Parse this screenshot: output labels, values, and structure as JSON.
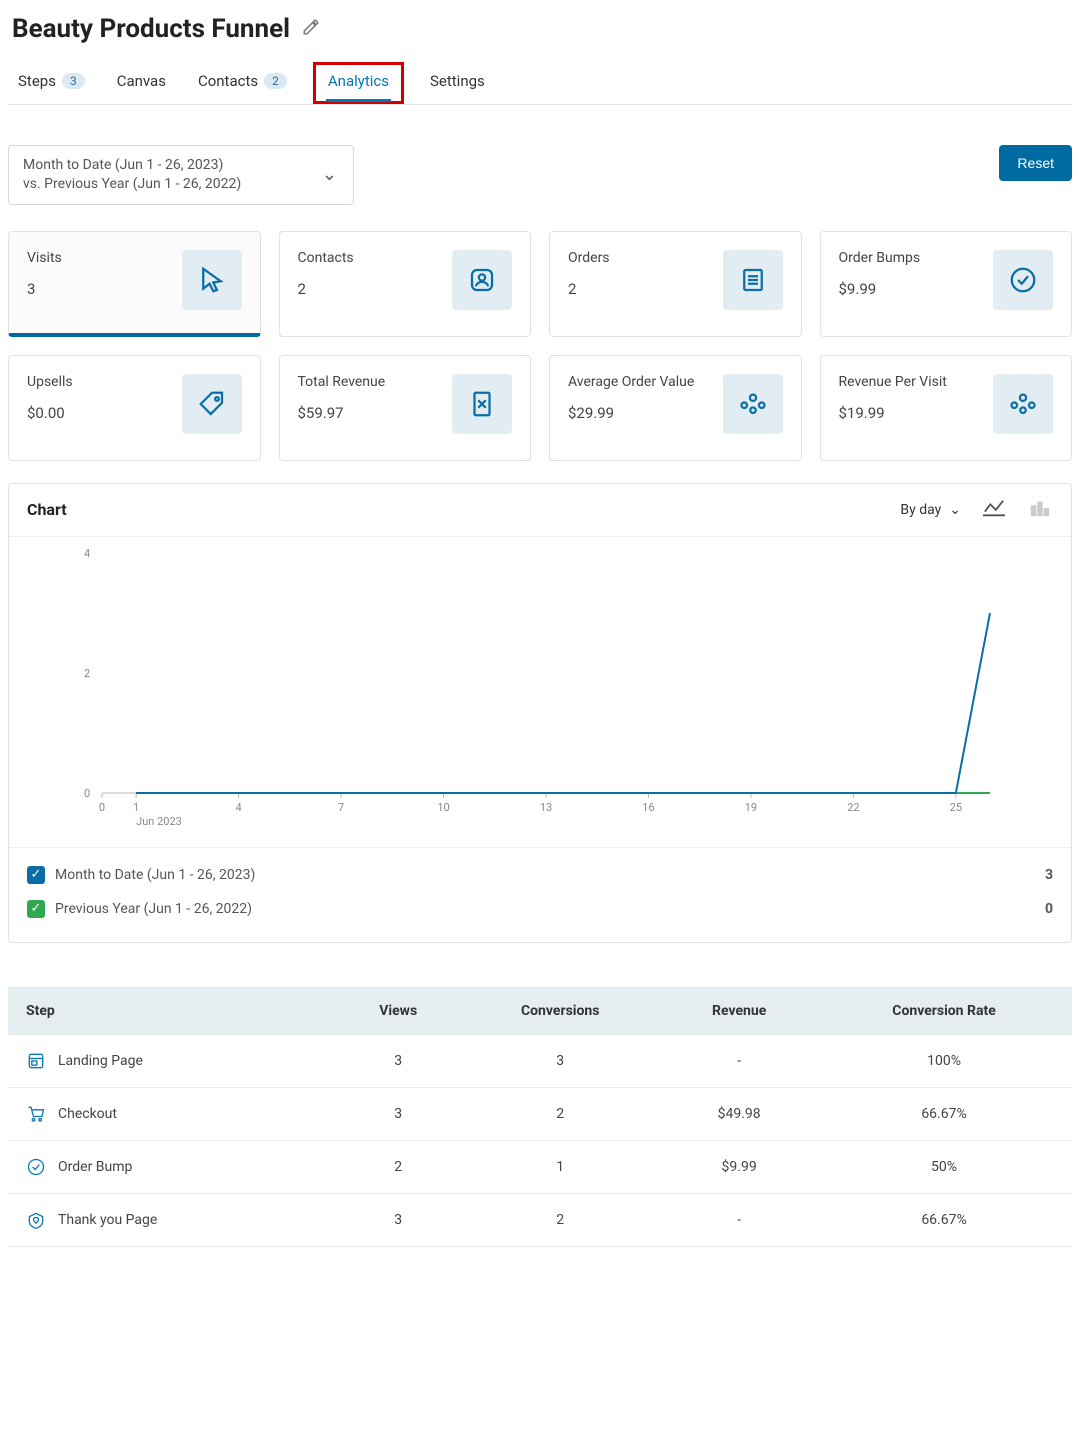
{
  "header": {
    "title": "Beauty Products Funnel"
  },
  "tabs": [
    {
      "label": "Steps",
      "badge": "3"
    },
    {
      "label": "Canvas"
    },
    {
      "label": "Contacts",
      "badge": "2"
    },
    {
      "label": "Analytics",
      "active": true,
      "highlighted": true
    },
    {
      "label": "Settings"
    }
  ],
  "date_picker": {
    "line1": "Month to Date (Jun 1 - 26, 2023)",
    "line2": "vs. Previous Year (Jun 1 - 26, 2022)"
  },
  "reset_label": "Reset",
  "metrics": [
    {
      "label": "Visits",
      "value": "3",
      "icon": "cursor",
      "selected": true
    },
    {
      "label": "Contacts",
      "value": "2",
      "icon": "contact"
    },
    {
      "label": "Orders",
      "value": "2",
      "icon": "orders"
    },
    {
      "label": "Order Bumps",
      "value": "$9.99",
      "icon": "check"
    },
    {
      "label": "Upsells",
      "value": "$0.00",
      "icon": "tag"
    },
    {
      "label": "Total Revenue",
      "value": "$59.97",
      "icon": "revenue"
    },
    {
      "label": "Average Order Value",
      "value": "$29.99",
      "icon": "people"
    },
    {
      "label": "Revenue Per Visit",
      "value": "$19.99",
      "icon": "people"
    }
  ],
  "chart": {
    "title": "Chart",
    "granularity": "By day"
  },
  "chart_data": {
    "type": "line",
    "x": [
      0,
      1,
      4,
      7,
      10,
      13,
      16,
      19,
      22,
      25
    ],
    "xlabel_under": "Jun 2023",
    "ylim": [
      0,
      4
    ],
    "yticks": [
      0,
      2,
      4
    ],
    "series": [
      {
        "name": "Month to Date (Jun 1 - 26, 2023)",
        "color": "#0a6ea4",
        "points": [
          [
            1,
            0
          ],
          [
            4,
            0
          ],
          [
            7,
            0
          ],
          [
            10,
            0
          ],
          [
            13,
            0
          ],
          [
            16,
            0
          ],
          [
            19,
            0
          ],
          [
            22,
            0
          ],
          [
            25,
            0
          ],
          [
            26,
            3
          ]
        ],
        "total": "3"
      },
      {
        "name": "Previous Year (Jun 1 - 26, 2022)",
        "color": "#2fa84f",
        "points": [
          [
            1,
            0
          ],
          [
            26,
            0
          ]
        ],
        "total": "0"
      }
    ]
  },
  "table": {
    "columns": [
      "Step",
      "Views",
      "Conversions",
      "Revenue",
      "Conversion Rate"
    ],
    "rows": [
      {
        "icon": "landing",
        "name": "Landing Page",
        "views": "3",
        "conv": "3",
        "rev": "-",
        "rate": "100%"
      },
      {
        "icon": "cart",
        "name": "Checkout",
        "views": "3",
        "conv": "2",
        "rev": "$49.98",
        "rate": "66.67%"
      },
      {
        "icon": "bump",
        "name": "Order Bump",
        "views": "2",
        "conv": "1",
        "rev": "$9.99",
        "rate": "50%"
      },
      {
        "icon": "thanks",
        "name": "Thank you Page",
        "views": "3",
        "conv": "2",
        "rev": "-",
        "rate": "66.67%"
      }
    ]
  }
}
